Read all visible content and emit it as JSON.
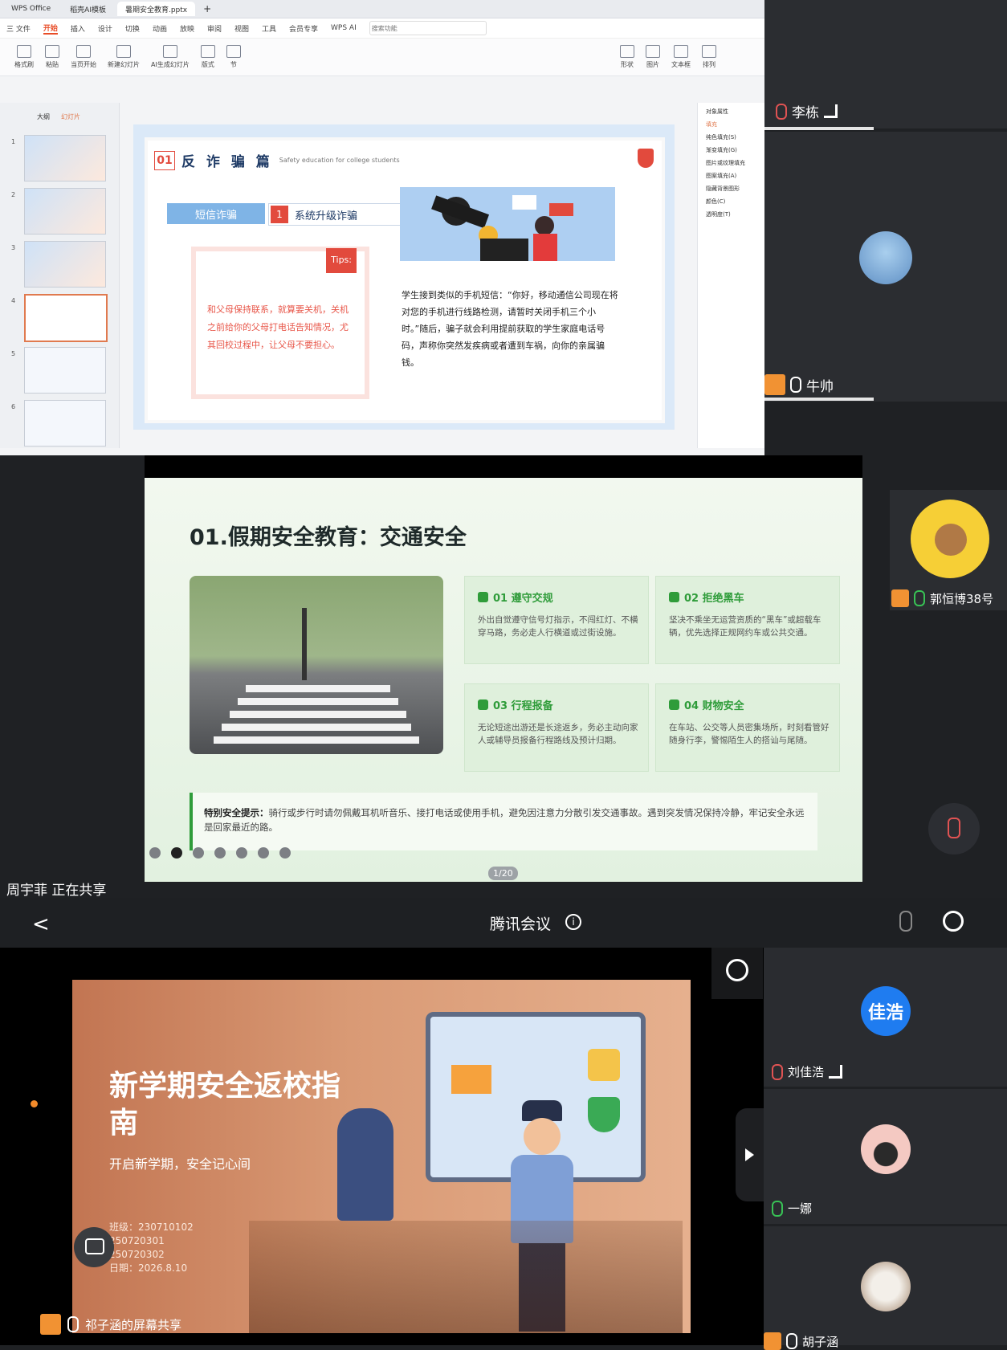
{
  "wps": {
    "tabs": [
      "WPS Office",
      "稻壳AI模板",
      "暑期安全教育.pptx"
    ],
    "menu": [
      "三 文件",
      "开始",
      "插入",
      "设计",
      "切换",
      "动画",
      "放映",
      "审阅",
      "视图",
      "工具",
      "会员专享",
      "WPS AI"
    ],
    "search_placeholder": "搜索功能",
    "toolbar": [
      "格式刷",
      "粘贴",
      "当页开始",
      "新建幻灯片",
      "AI生成幻灯片",
      "版式",
      "节",
      "形状",
      "图片",
      "文本框",
      "排列"
    ],
    "left_tabs": [
      "大纲",
      "幻灯片"
    ],
    "slide_nums": [
      "1",
      "2",
      "3",
      "4",
      "5",
      "6"
    ],
    "right_panel": [
      "对象属性",
      "填充",
      "纯色填充(S)",
      "渐变填充(G)",
      "图片或纹理填充",
      "图案填充(A)",
      "隐藏背景图形",
      "颜色(C)",
      "透明度(T)"
    ]
  },
  "slide1": {
    "num": "01",
    "title": "反 诈 骗 篇",
    "subtitle": "Safety education for college students",
    "tab1": "短信诈骗",
    "tab2_num": "1",
    "tab2": "系统升级诈骗",
    "tips": "Tips:",
    "tip_text": "和父母保持联系，就算要关机，关机之前给你的父母打电话告知情况，尤其回校过程中，让父母不要担心。",
    "body": "学生接到类似的手机短信：“你好，移动通信公司现在将对您的手机进行线路检测，请暂时关闭手机三个小时。”随后，骗子就会利用提前获取的学生家庭电话号码，声称你突然发疾病或者遭到车祸，向你的亲属骗钱。"
  },
  "slide2": {
    "title": "01.假期安全教育：交通安全",
    "cards": [
      {
        "title": "01 遵守交规",
        "body": "外出自觉遵守信号灯指示，不闯红灯、不横穿马路，务必走人行横道或过街设施。"
      },
      {
        "title": "02 拒绝黑车",
        "body": "坚决不乘坐无运营资质的“黑车”或超载车辆，优先选择正规网约车或公共交通。"
      },
      {
        "title": "03 行程报备",
        "body": "无论短途出游还是长途返乡，务必主动向家人或辅导员报备行程路线及预计归期。"
      },
      {
        "title": "04 财物安全",
        "body": "在车站、公交等人员密集场所，时刻看管好随身行李，警惕陌生人的搭讪与尾随。"
      }
    ],
    "tip_label": "特别安全提示：",
    "tip_text": "骑行或步行时请勿佩戴耳机听音乐、接打电话或使用手机，避免因注意力分散引发交通事故。遇到突发情况保持冷静，牢记安全永远是回家最近的路。",
    "page": "1/20"
  },
  "sharing_label": "周宇菲 正在共享",
  "participants_top": [
    {
      "name": "李栋"
    },
    {
      "name": "牛帅"
    },
    {
      "name": "郭恒博38号"
    }
  ],
  "meeting": {
    "title": "腾讯会议",
    "back": "<",
    "info_icon": "i"
  },
  "slide3": {
    "title": "新学期安全返校指南",
    "subtitle": "开启新学期，安全记心间",
    "info": [
      "班级：230710102",
      "250720301",
      "250720302",
      "日期：2026.8.10"
    ]
  },
  "participants_bottom": [
    {
      "avatar_text": "佳浩",
      "name": "刘佳浩"
    },
    {
      "name": "一娜"
    },
    {
      "name": "胡子涵"
    }
  ],
  "bottom_share": "祁子涵的屏幕共享",
  "colors": {
    "accent_red": "#e24a3d",
    "accent_green": "#2f9c3a",
    "meeting_bg": "#1f2124",
    "avatar_blue": "#1f7cf0"
  }
}
